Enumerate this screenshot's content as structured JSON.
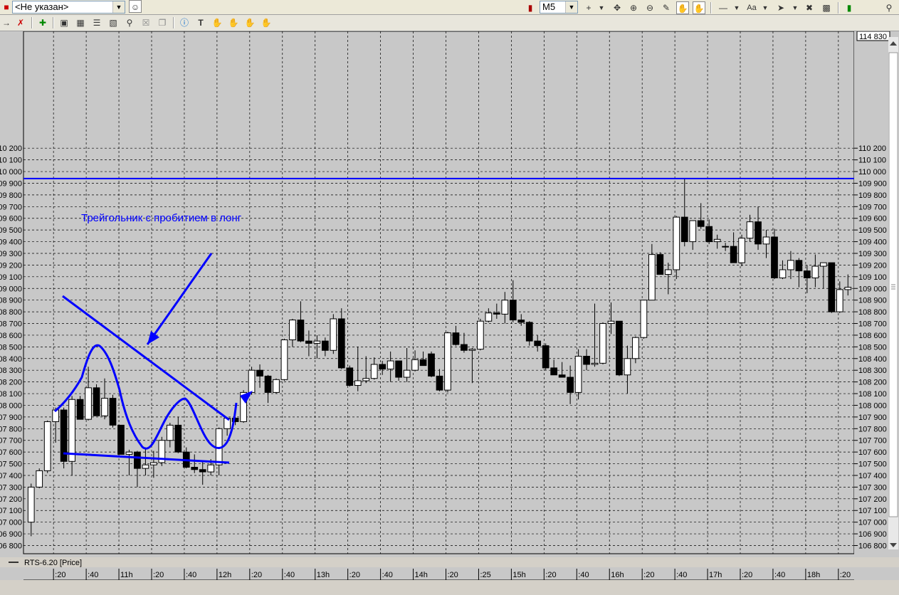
{
  "toolbar": {
    "instrument_select": "<Не указан>",
    "timeframe_select": "M5",
    "font_button": "Aa"
  },
  "chart_data": {
    "type": "candlestick",
    "series_label": "RTS-6.20 [Price]",
    "current_price_label": "114 830",
    "ylim": [
      106730,
      111200
    ],
    "y_ticks": [
      106800,
      106900,
      107000,
      107100,
      107200,
      107300,
      107400,
      107500,
      107600,
      107700,
      107800,
      107900,
      108000,
      108100,
      108200,
      108300,
      108400,
      108500,
      108600,
      108700,
      108800,
      108900,
      109000,
      109100,
      109200,
      109300,
      109400,
      109500,
      109600,
      109700,
      109800,
      109900,
      110000,
      110100,
      110200
    ],
    "y_tick_labels": [
      "106 800",
      "106 900",
      "107 000",
      "107 100",
      "107 200",
      "107 300",
      "107 400",
      "107 500",
      "107 600",
      "107 700",
      "107 800",
      "107 900",
      "108 000",
      "108 100",
      "108 200",
      "108 300",
      "108 400",
      "108 500",
      "108 600",
      "108 700",
      "108 800",
      "108 900",
      "109 000",
      "109 100",
      "109 200",
      "109 300",
      "109 400",
      "109 500",
      "109 600",
      "109 700",
      "109 800",
      "109 900",
      "110 000",
      "110 100",
      "110 200"
    ],
    "x_labels": [
      ":20",
      ":40",
      "11h",
      ":20",
      ":40",
      "12h",
      ":20",
      ":40",
      "13h",
      ":20",
      ":40",
      "14h",
      ":20",
      ":25",
      "15h",
      ":20",
      ":40",
      "16h",
      ":20",
      ":40",
      "17h",
      ":20",
      ":40",
      "18h",
      ":20"
    ],
    "grid": true,
    "candles": [
      {
        "o": 107000,
        "h": 107330,
        "l": 106880,
        "c": 107300
      },
      {
        "o": 107300,
        "h": 107460,
        "l": 107290,
        "c": 107440
      },
      {
        "o": 107440,
        "h": 107870,
        "l": 107420,
        "c": 107860
      },
      {
        "o": 107860,
        "h": 107980,
        "l": 107680,
        "c": 107960
      },
      {
        "o": 107960,
        "h": 107980,
        "l": 107460,
        "c": 107520
      },
      {
        "o": 107520,
        "h": 108080,
        "l": 107400,
        "c": 108050
      },
      {
        "o": 108050,
        "h": 108080,
        "l": 107880,
        "c": 107880
      },
      {
        "o": 107880,
        "h": 108330,
        "l": 107870,
        "c": 108150
      },
      {
        "o": 108150,
        "h": 108180,
        "l": 107910,
        "c": 107910
      },
      {
        "o": 107910,
        "h": 108230,
        "l": 107880,
        "c": 108060
      },
      {
        "o": 108060,
        "h": 108090,
        "l": 107810,
        "c": 107830
      },
      {
        "o": 107830,
        "h": 107830,
        "l": 107580,
        "c": 107580
      },
      {
        "o": 107580,
        "h": 107620,
        "l": 107400,
        "c": 107600
      },
      {
        "o": 107600,
        "h": 107610,
        "l": 107300,
        "c": 107460
      },
      {
        "o": 107460,
        "h": 107640,
        "l": 107400,
        "c": 107490
      },
      {
        "o": 107490,
        "h": 107610,
        "l": 107380,
        "c": 107510
      },
      {
        "o": 107510,
        "h": 107730,
        "l": 107480,
        "c": 107700
      },
      {
        "o": 107700,
        "h": 107850,
        "l": 107640,
        "c": 107830
      },
      {
        "o": 107830,
        "h": 107900,
        "l": 107590,
        "c": 107600
      },
      {
        "o": 107600,
        "h": 107640,
        "l": 107460,
        "c": 107470
      },
      {
        "o": 107470,
        "h": 107580,
        "l": 107420,
        "c": 107450
      },
      {
        "o": 107450,
        "h": 107520,
        "l": 107320,
        "c": 107430
      },
      {
        "o": 107430,
        "h": 107540,
        "l": 107400,
        "c": 107490
      },
      {
        "o": 107490,
        "h": 107810,
        "l": 107400,
        "c": 107800
      },
      {
        "o": 107800,
        "h": 107900,
        "l": 107740,
        "c": 107890
      },
      {
        "o": 107890,
        "h": 107900,
        "l": 107830,
        "c": 107860
      },
      {
        "o": 107860,
        "h": 108130,
        "l": 107850,
        "c": 108110
      },
      {
        "o": 108110,
        "h": 108330,
        "l": 108090,
        "c": 108300
      },
      {
        "o": 108300,
        "h": 108350,
        "l": 108150,
        "c": 108250
      },
      {
        "o": 108250,
        "h": 108260,
        "l": 108020,
        "c": 108110
      },
      {
        "o": 108110,
        "h": 108230,
        "l": 108100,
        "c": 108220
      },
      {
        "o": 108220,
        "h": 108570,
        "l": 108210,
        "c": 108560
      },
      {
        "o": 108560,
        "h": 108740,
        "l": 108500,
        "c": 108730
      },
      {
        "o": 108730,
        "h": 108890,
        "l": 108540,
        "c": 108550
      },
      {
        "o": 108550,
        "h": 108640,
        "l": 108420,
        "c": 108530
      },
      {
        "o": 108530,
        "h": 108600,
        "l": 108400,
        "c": 108550
      },
      {
        "o": 108550,
        "h": 108580,
        "l": 108420,
        "c": 108470
      },
      {
        "o": 108470,
        "h": 108780,
        "l": 108440,
        "c": 108740
      },
      {
        "o": 108740,
        "h": 108830,
        "l": 108310,
        "c": 108320
      },
      {
        "o": 108320,
        "h": 108340,
        "l": 108160,
        "c": 108170
      },
      {
        "o": 108170,
        "h": 108500,
        "l": 108120,
        "c": 108210
      },
      {
        "o": 108210,
        "h": 108420,
        "l": 108190,
        "c": 108230
      },
      {
        "o": 108230,
        "h": 108410,
        "l": 108220,
        "c": 108350
      },
      {
        "o": 108350,
        "h": 108380,
        "l": 108260,
        "c": 108310
      },
      {
        "o": 108310,
        "h": 108460,
        "l": 108200,
        "c": 108380
      },
      {
        "o": 108380,
        "h": 108380,
        "l": 108210,
        "c": 108240
      },
      {
        "o": 108240,
        "h": 108490,
        "l": 108200,
        "c": 108300
      },
      {
        "o": 108300,
        "h": 108470,
        "l": 108290,
        "c": 108390
      },
      {
        "o": 108390,
        "h": 108460,
        "l": 108360,
        "c": 108340
      },
      {
        "o": 108440,
        "h": 108460,
        "l": 108240,
        "c": 108250
      },
      {
        "o": 108250,
        "h": 108310,
        "l": 108120,
        "c": 108130
      },
      {
        "o": 108130,
        "h": 108630,
        "l": 108110,
        "c": 108620
      },
      {
        "o": 108620,
        "h": 108680,
        "l": 108510,
        "c": 108520
      },
      {
        "o": 108520,
        "h": 108620,
        "l": 108450,
        "c": 108470
      },
      {
        "o": 108470,
        "h": 108490,
        "l": 108190,
        "c": 108480
      },
      {
        "o": 108480,
        "h": 108740,
        "l": 108470,
        "c": 108720
      },
      {
        "o": 108720,
        "h": 108830,
        "l": 108710,
        "c": 108790
      },
      {
        "o": 108790,
        "h": 108870,
        "l": 108740,
        "c": 108780
      },
      {
        "o": 108780,
        "h": 108970,
        "l": 108700,
        "c": 108900
      },
      {
        "o": 108900,
        "h": 109070,
        "l": 108710,
        "c": 108730
      },
      {
        "o": 108730,
        "h": 108780,
        "l": 108680,
        "c": 108710
      },
      {
        "o": 108710,
        "h": 108720,
        "l": 108510,
        "c": 108550
      },
      {
        "o": 108550,
        "h": 108600,
        "l": 108460,
        "c": 108510
      },
      {
        "o": 108510,
        "h": 108530,
        "l": 108300,
        "c": 108320
      },
      {
        "o": 108320,
        "h": 108390,
        "l": 108260,
        "c": 108260
      },
      {
        "o": 108260,
        "h": 108370,
        "l": 108250,
        "c": 108240
      },
      {
        "o": 108240,
        "h": 108340,
        "l": 108010,
        "c": 108110
      },
      {
        "o": 108110,
        "h": 108480,
        "l": 108050,
        "c": 108420
      },
      {
        "o": 108420,
        "h": 108480,
        "l": 108300,
        "c": 108350
      },
      {
        "o": 108350,
        "h": 108870,
        "l": 108330,
        "c": 108360
      },
      {
        "o": 108360,
        "h": 108710,
        "l": 108350,
        "c": 108700
      },
      {
        "o": 108700,
        "h": 108880,
        "l": 108610,
        "c": 108720
      },
      {
        "o": 108720,
        "h": 108720,
        "l": 108250,
        "c": 108260
      },
      {
        "o": 108260,
        "h": 108510,
        "l": 108100,
        "c": 108400
      },
      {
        "o": 108400,
        "h": 108590,
        "l": 108360,
        "c": 108580
      },
      {
        "o": 108580,
        "h": 108900,
        "l": 108570,
        "c": 108900
      },
      {
        "o": 108900,
        "h": 109380,
        "l": 108930,
        "c": 109290
      },
      {
        "o": 109290,
        "h": 109310,
        "l": 109130,
        "c": 109120
      },
      {
        "o": 109120,
        "h": 109220,
        "l": 108950,
        "c": 109160
      },
      {
        "o": 109160,
        "h": 109620,
        "l": 109080,
        "c": 109610
      },
      {
        "o": 109610,
        "h": 109940,
        "l": 109360,
        "c": 109400
      },
      {
        "o": 109400,
        "h": 109580,
        "l": 109330,
        "c": 109580
      },
      {
        "o": 109580,
        "h": 109730,
        "l": 109510,
        "c": 109530
      },
      {
        "o": 109530,
        "h": 109590,
        "l": 109380,
        "c": 109400
      },
      {
        "o": 109400,
        "h": 109460,
        "l": 109340,
        "c": 109420
      },
      {
        "o": 109360,
        "h": 109390,
        "l": 109320,
        "c": 109360
      },
      {
        "o": 109360,
        "h": 109480,
        "l": 109220,
        "c": 109220
      },
      {
        "o": 109220,
        "h": 109460,
        "l": 109190,
        "c": 109430
      },
      {
        "o": 109430,
        "h": 109630,
        "l": 109400,
        "c": 109570
      },
      {
        "o": 109570,
        "h": 109700,
        "l": 109330,
        "c": 109380
      },
      {
        "o": 109380,
        "h": 109500,
        "l": 109260,
        "c": 109440
      },
      {
        "o": 109440,
        "h": 109510,
        "l": 109080,
        "c": 109090
      },
      {
        "o": 109090,
        "h": 109240,
        "l": 109080,
        "c": 109160
      },
      {
        "o": 109160,
        "h": 109320,
        "l": 109080,
        "c": 109240
      },
      {
        "o": 109240,
        "h": 109260,
        "l": 109010,
        "c": 109150
      },
      {
        "o": 109150,
        "h": 109200,
        "l": 108960,
        "c": 109090
      },
      {
        "o": 109090,
        "h": 109290,
        "l": 109010,
        "c": 109190
      },
      {
        "o": 109190,
        "h": 109220,
        "l": 109000,
        "c": 109220
      },
      {
        "o": 109220,
        "h": 109220,
        "l": 108790,
        "c": 108800
      },
      {
        "o": 108800,
        "h": 109060,
        "l": 108790,
        "c": 108990
      },
      {
        "o": 108990,
        "h": 109120,
        "l": 108940,
        "c": 109010
      }
    ]
  },
  "drawing": {
    "annotation_text": "Трейгольник с пробитием в лонг",
    "horizontal_level": 109940,
    "line_color": "#0000ff"
  }
}
